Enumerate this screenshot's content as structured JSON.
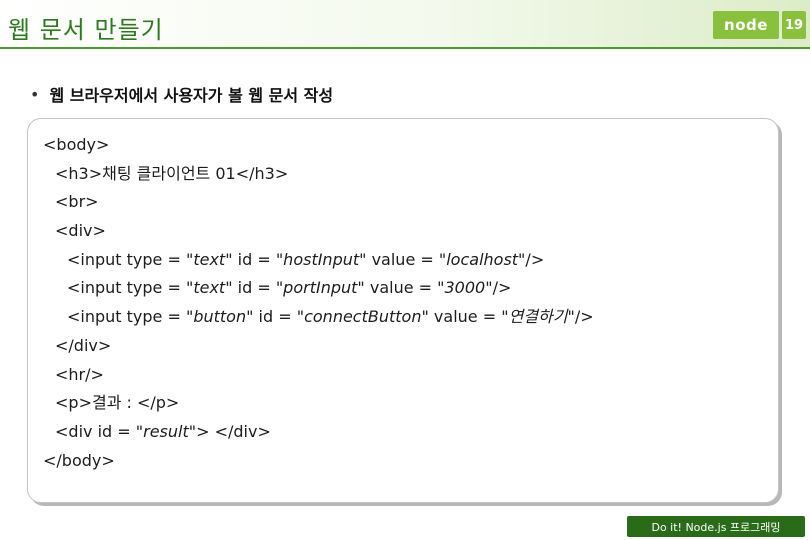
{
  "slide": {
    "title": "웹 문서 만들기",
    "page_number": "19",
    "logo_text": "node",
    "bullet": "웹 브라우저에서 사용자가 볼 웹 문서 작성",
    "footer": "Do it! Node.js 프로그래밍"
  },
  "code": {
    "l1": "<body>",
    "l2_open": "<h3>",
    "l2_text": "채팅 클라이언트 01",
    "l2_close": "</h3>",
    "l3": "<br>",
    "l4": "<div>",
    "l5_a": "<input type = ",
    "l5_s1": "\"text\"",
    "l5_b": " id = ",
    "l5_s2": "\"hostInput\"",
    "l5_c": " value = ",
    "l5_s3": "\"localhost\"",
    "l5_d": "/>",
    "l6_a": "<input type = ",
    "l6_s1": "\"text\"",
    "l6_b": " id = ",
    "l6_s2": "\"portInput\"",
    "l6_c": " value = ",
    "l6_s3": "\"3000\"",
    "l6_d": "/>",
    "l7_a": "<input type = ",
    "l7_s1": "\"button\"",
    "l7_b": " id = ",
    "l7_s2": "\"connectButton\"",
    "l7_c": " value = ",
    "l7_s3": "\"연결하기\"",
    "l7_d": "/>",
    "l8": "</div>",
    "l9": "<hr/>",
    "l10": "<p>결과 : </p>",
    "l11_a": "<div id = ",
    "l11_s": "\"result\"",
    "l11_b": "> </div>",
    "l12": "</body>"
  }
}
